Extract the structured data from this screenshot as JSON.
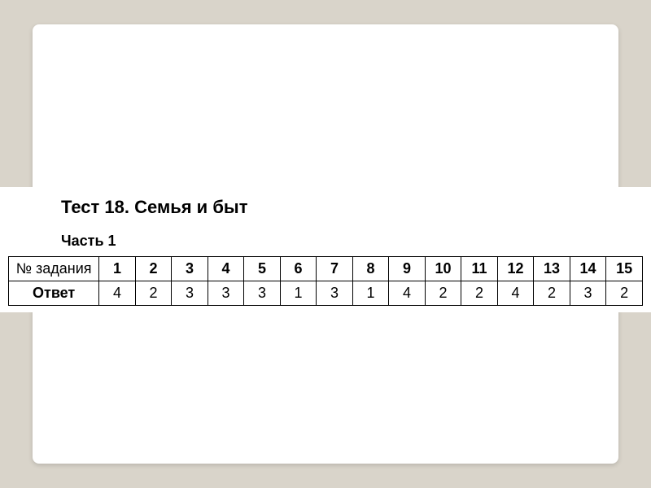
{
  "title": "Тест 18. Семья и быт",
  "subtitle": "Часть 1",
  "table": {
    "rowLabels": [
      "№ задания",
      "Ответ"
    ],
    "numbers": [
      "1",
      "2",
      "3",
      "4",
      "5",
      "6",
      "7",
      "8",
      "9",
      "10",
      "11",
      "12",
      "13",
      "14",
      "15"
    ],
    "answers": [
      "4",
      "2",
      "3",
      "3",
      "3",
      "1",
      "3",
      "1",
      "4",
      "2",
      "2",
      "4",
      "2",
      "3",
      "2"
    ]
  }
}
